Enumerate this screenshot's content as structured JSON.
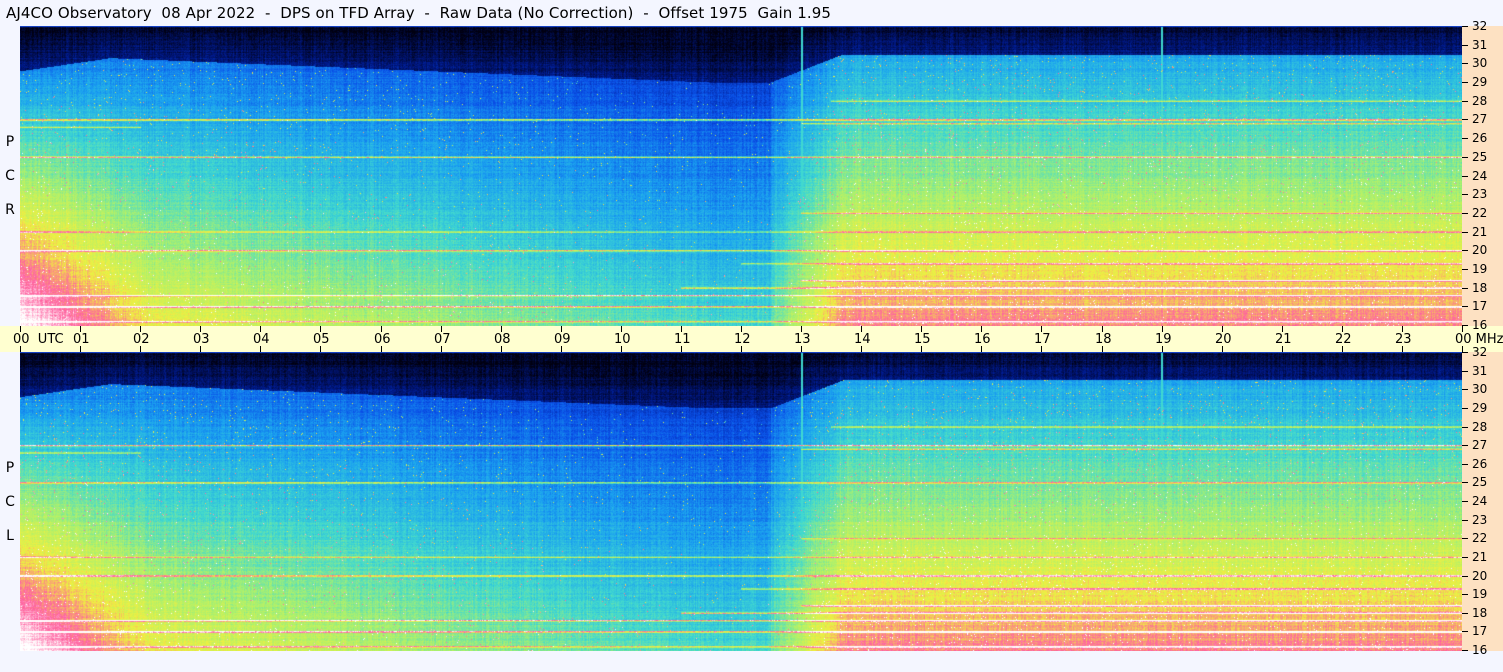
{
  "title": "AJ4CO Observatory  08 Apr 2022  -  DPS on TFD Array  -  Raw Data (No Correction)  -  Offset 1975  Gain 1.95",
  "chart_data": [
    {
      "type": "heatmap",
      "panel": "RCP",
      "polarization_letters": [
        "P",
        "C",
        "R"
      ],
      "y_axis": {
        "unit": "MHz",
        "min": 16,
        "max": 32,
        "ticks": [
          16,
          17,
          18,
          19,
          20,
          21,
          22,
          23,
          24,
          25,
          26,
          27,
          28,
          29,
          30,
          31,
          32
        ]
      },
      "x_axis": {
        "unit": "UTC",
        "range_hours": [
          0,
          24
        ]
      },
      "colormap": [
        "#000010",
        "#001a8c",
        "#0a50e8",
        "#1aa0f0",
        "#40d8d0",
        "#a8f070",
        "#f0f040",
        "#ff60a0",
        "#ffffff"
      ],
      "vertical_markers_utc": [
        13.0,
        19.0
      ]
    },
    {
      "type": "heatmap",
      "panel": "LCP",
      "polarization_letters": [
        "P",
        "C",
        "L"
      ],
      "y_axis": {
        "unit": "MHz",
        "min": 16,
        "max": 32,
        "ticks": [
          16,
          17,
          18,
          19,
          20,
          21,
          22,
          23,
          24,
          25,
          26,
          27,
          28,
          29,
          30,
          31,
          32
        ]
      },
      "x_axis": {
        "unit": "UTC",
        "range_hours": [
          0,
          24
        ]
      },
      "colormap": [
        "#000010",
        "#001a8c",
        "#0a50e8",
        "#1aa0f0",
        "#40d8d0",
        "#a8f070",
        "#f0f040",
        "#ff60a0",
        "#ffffff"
      ],
      "vertical_markers_utc": [
        13.0,
        19.0
      ]
    }
  ],
  "time_axis": {
    "labels": [
      "00  UTC",
      "01",
      "02",
      "03",
      "04",
      "05",
      "06",
      "07",
      "08",
      "09",
      "10",
      "11",
      "12",
      "13",
      "14",
      "15",
      "16",
      "17",
      "18",
      "19",
      "20",
      "21",
      "22",
      "23",
      "00 MHz"
    ]
  }
}
